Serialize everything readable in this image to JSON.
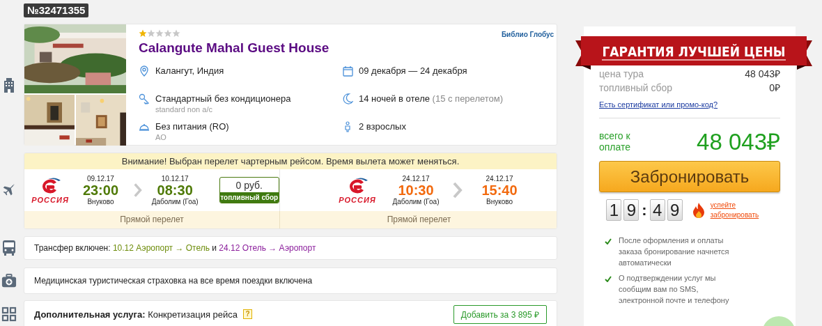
{
  "order_number": "№32471355",
  "hotel": {
    "stars": 1,
    "name": "Calangute Mahal Guest House",
    "operator": "Библио Глобус",
    "details": [
      {
        "kind": "pin",
        "text": "Калангут, Индия"
      },
      {
        "kind": "calendar",
        "text": "09 декабря — 24 декабря"
      },
      {
        "kind": "key",
        "text": "Стандартный без кондиционера",
        "note": "standard non a/c"
      },
      {
        "kind": "moon",
        "text": "14 ночей в отеле",
        "note": "(15 с перелетом)"
      },
      {
        "kind": "dish",
        "text": "Без питания (RO)",
        "note": "AO"
      },
      {
        "kind": "person",
        "text": "2 взрослых"
      }
    ]
  },
  "flights": {
    "notice": "Внимание! Выбран перелет чартерным рейсом. Время вылета может меняться.",
    "fuel": {
      "price": "0 руб.",
      "label": "топливный сбор"
    },
    "legs": [
      {
        "airline": "РОССИЯ",
        "color": "#4f7a08",
        "route": "Прямой перелет",
        "depart": {
          "date": "09.12.17",
          "time": "23:00",
          "airport": "Внуково"
        },
        "arrive": {
          "date": "10.12.17",
          "time": "08:30",
          "airport": "Даболим (Гоа)"
        }
      },
      {
        "airline": "РОССИЯ",
        "color": "#f26a0f",
        "route": "Прямой перелет",
        "depart": {
          "date": "24.12.17",
          "time": "10:30",
          "airport": "Даболим (Гоа)"
        },
        "arrive": {
          "date": "24.12.17",
          "time": "15:40",
          "airport": "Внуково"
        }
      }
    ]
  },
  "transfer": {
    "label": "Трансфер включен:",
    "joiner": "и",
    "legs": [
      {
        "text": "10.12 Аэропорт → Отель",
        "color": "#6d8c0a"
      },
      {
        "text": "24.12 Отель → Аэропорт",
        "color": "#8b1f9c"
      }
    ]
  },
  "insurance": "Медицинская туристическая страховка на все время поездки включена",
  "extra": {
    "label": "Дополнительная услуга:",
    "value": "Конкретизация рейса",
    "help": "?",
    "button": "Добавить за 3 895 ₽"
  },
  "price": {
    "banner": "ГАРАНТИЯ ЛУЧШЕЙ ЦЕНЫ",
    "lines": [
      {
        "label": "цена тура",
        "value": "48 043₽"
      },
      {
        "label": "топливный сбор",
        "value": "0₽"
      }
    ],
    "promo_link": "Есть сертификат или промо-код?",
    "total_label": "всего к оплате",
    "total": "48 043₽",
    "book_button": "Забронировать",
    "timer": {
      "minutes": [
        "1",
        "9"
      ],
      "separator": ":",
      "seconds": [
        "4",
        "9"
      ]
    },
    "hurry_link": "успейте забронировать",
    "benefits": [
      "После оформления и оплаты заказа бронирование начнется автоматически",
      "О подтверждении услуг мы сообщим вам по SMS, электронной почте и телефону"
    ]
  }
}
